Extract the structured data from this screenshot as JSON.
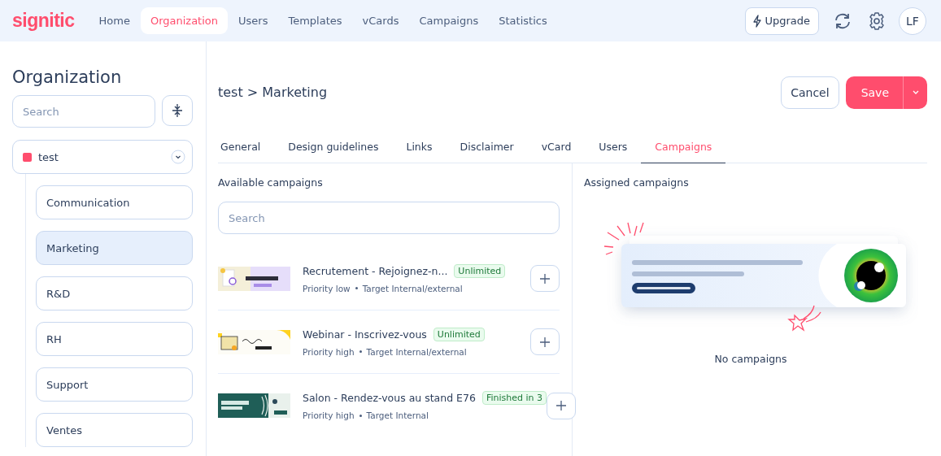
{
  "brand": "signitic",
  "nav": [
    {
      "label": "Home",
      "selected": false
    },
    {
      "label": "Organization",
      "selected": true
    },
    {
      "label": "Users",
      "selected": false
    },
    {
      "label": "Templates",
      "selected": false
    },
    {
      "label": "vCards",
      "selected": false
    },
    {
      "label": "Campaigns",
      "selected": false
    },
    {
      "label": "Statistics",
      "selected": false
    }
  ],
  "upgrade": "Upgrade",
  "avatar": "LF",
  "sidebar": {
    "title": "Organization",
    "search": {
      "placeholder": "Search"
    },
    "tree": {
      "label": "test",
      "color": "#ff4d6d",
      "expanded": true,
      "children": [
        {
          "label": "Communication",
          "selected": false
        },
        {
          "label": "Marketing",
          "selected": true
        },
        {
          "label": "R&D",
          "selected": false
        },
        {
          "label": "RH",
          "selected": false
        },
        {
          "label": "Support",
          "selected": false
        },
        {
          "label": "Ventes",
          "selected": false
        }
      ]
    }
  },
  "breadcrumb": "test > Marketing",
  "cancel": "Cancel",
  "save": "Save",
  "tabs": [
    {
      "label": "General",
      "selected": false
    },
    {
      "label": "Design guidelines",
      "selected": false
    },
    {
      "label": "Links",
      "selected": false
    },
    {
      "label": "Disclaimer",
      "selected": false
    },
    {
      "label": "vCard",
      "selected": false
    },
    {
      "label": "Users",
      "selected": false
    },
    {
      "label": "Campaigns",
      "selected": true
    }
  ],
  "available": {
    "title": "Available campaigns",
    "search": {
      "placeholder": "Search"
    },
    "campaigns": [
      {
        "name": "Recrutement - Rejoignez-n...",
        "badge": "Unlimited",
        "priority": "Priority low",
        "target": "Target Internal/external"
      },
      {
        "name": "Webinar - Inscrivez-vous",
        "badge": "Unlimited",
        "priority": "Priority high",
        "target": "Target Internal/external"
      },
      {
        "name": "Salon - Rendez-vous au stand E76",
        "badge": "Finished in 3",
        "priority": "Priority high",
        "target": "Target Internal"
      }
    ]
  },
  "assigned": {
    "title": "Assigned campaigns",
    "empty": "No campaigns"
  }
}
